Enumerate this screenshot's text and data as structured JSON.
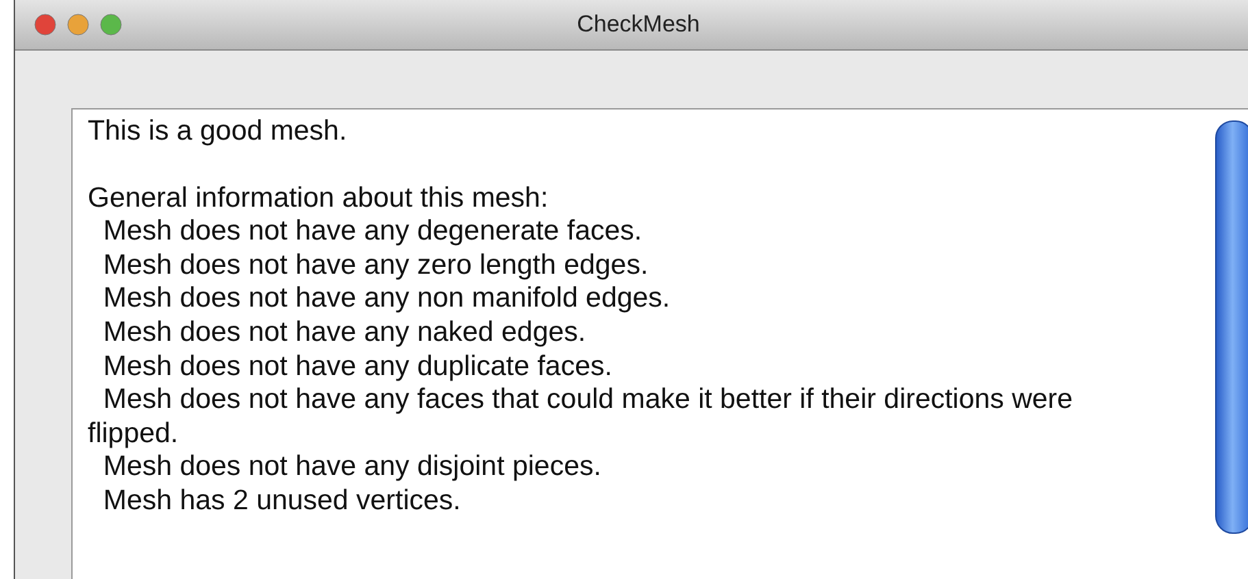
{
  "window": {
    "title": "CheckMesh"
  },
  "report": {
    "paragraphs": [
      [
        "This is a good mesh."
      ],
      [
        "General information about this mesh:",
        "  Mesh does not have any degenerate faces.",
        "  Mesh does not have any zero length edges.",
        "  Mesh does not have any non manifold edges.",
        "  Mesh does not have any naked edges.",
        "  Mesh does not have any duplicate faces.",
        "  Mesh does not have any faces that could make it better if their directions were flipped.",
        "  Mesh does not have any disjoint pieces.",
        "  Mesh has 2 unused vertices."
      ]
    ]
  }
}
